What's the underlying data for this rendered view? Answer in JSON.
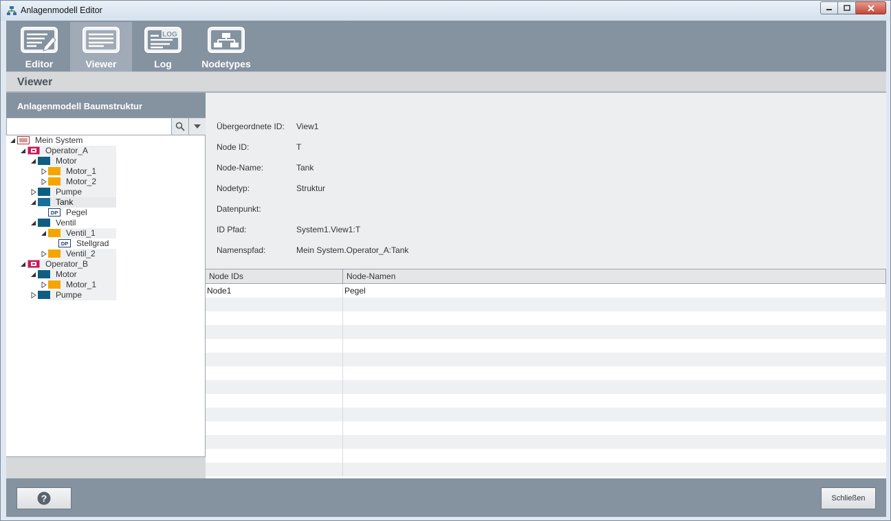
{
  "window": {
    "title": "Anlagenmodell Editor"
  },
  "toolbar": {
    "items": [
      {
        "label": "Editor",
        "icon": "editor-icon"
      },
      {
        "label": "Viewer",
        "icon": "viewer-icon",
        "active": true
      },
      {
        "label": "Log",
        "icon": "log-icon",
        "icon_text": "LOG"
      },
      {
        "label": "Nodetypes",
        "icon": "nodetypes-icon"
      }
    ]
  },
  "section": {
    "title": "Viewer"
  },
  "tree_panel": {
    "title": "Anlagenmodell Baumstruktur",
    "search": {
      "value": "",
      "placeholder": ""
    },
    "nodes": [
      {
        "label": "Mein System",
        "type": "system"
      },
      {
        "label": "Operator_A",
        "type": "operator"
      },
      {
        "label": "Motor",
        "type": "struct"
      },
      {
        "label": "Motor_1",
        "type": "element"
      },
      {
        "label": "Motor_2",
        "type": "element"
      },
      {
        "label": "Pumpe",
        "type": "struct"
      },
      {
        "label": "Tank",
        "type": "struct",
        "selected": true
      },
      {
        "label": "Pegel",
        "type": "datapoint",
        "icon_text": "DP"
      },
      {
        "label": "Ventil",
        "type": "struct"
      },
      {
        "label": "Ventil_1",
        "type": "element"
      },
      {
        "label": "Stellgrad",
        "type": "datapoint",
        "icon_text": "DP"
      },
      {
        "label": "Ventil_2",
        "type": "element"
      },
      {
        "label": "Operator_B",
        "type": "operator"
      },
      {
        "label": "Motor",
        "type": "struct"
      },
      {
        "label": "Motor_1",
        "type": "element"
      },
      {
        "label": "Pumpe",
        "type": "struct"
      }
    ]
  },
  "properties": [
    {
      "key": "Übergeordnete ID:",
      "value": "View1"
    },
    {
      "key": "Node ID:",
      "value": "T"
    },
    {
      "key": "Node-Name:",
      "value": "Tank"
    },
    {
      "key": "Nodetyp:",
      "value": "Struktur"
    },
    {
      "key": "Datenpunkt:",
      "value": ""
    },
    {
      "key": "ID Pfad:",
      "value": "System1.View1:T"
    },
    {
      "key": "Namenspfad:",
      "value": "Mein System.Operator_A:Tank"
    }
  ],
  "table": {
    "columns": [
      "Node IDs",
      "Node-Namen"
    ],
    "rows": [
      [
        "Node1",
        "Pegel"
      ]
    ]
  },
  "footer": {
    "help_label": "?",
    "close_label": "Schließen"
  },
  "colors": {
    "toolbar": "#8592a0",
    "operator": "#c8195a",
    "struct": "#0f5e82",
    "element": "#f5a500",
    "system": "#b03030"
  }
}
